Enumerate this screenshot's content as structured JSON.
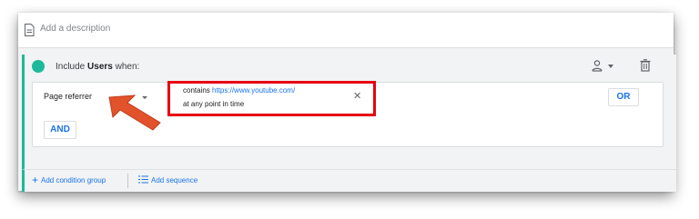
{
  "description": {
    "placeholder": "Add a description",
    "icon": "document-icon"
  },
  "group": {
    "prefix": "Include",
    "subject": "Users",
    "suffix": "when:",
    "accent_color": "#1db99a",
    "icons": [
      "person-icon",
      "chevron-down-icon",
      "trash-icon"
    ]
  },
  "condition": {
    "dimension": "Page referrer",
    "operator": "contains",
    "value": "https://www.youtube.com/",
    "scope": "at any point in time",
    "remove_icon": "close-icon",
    "highlight_color": "#e60012"
  },
  "buttons": {
    "or": "OR",
    "and": "AND"
  },
  "footer": {
    "add_condition_group": "Add condition group",
    "add_sequence": "Add sequence"
  },
  "annotation": {
    "arrow_color": "#e2522b"
  }
}
